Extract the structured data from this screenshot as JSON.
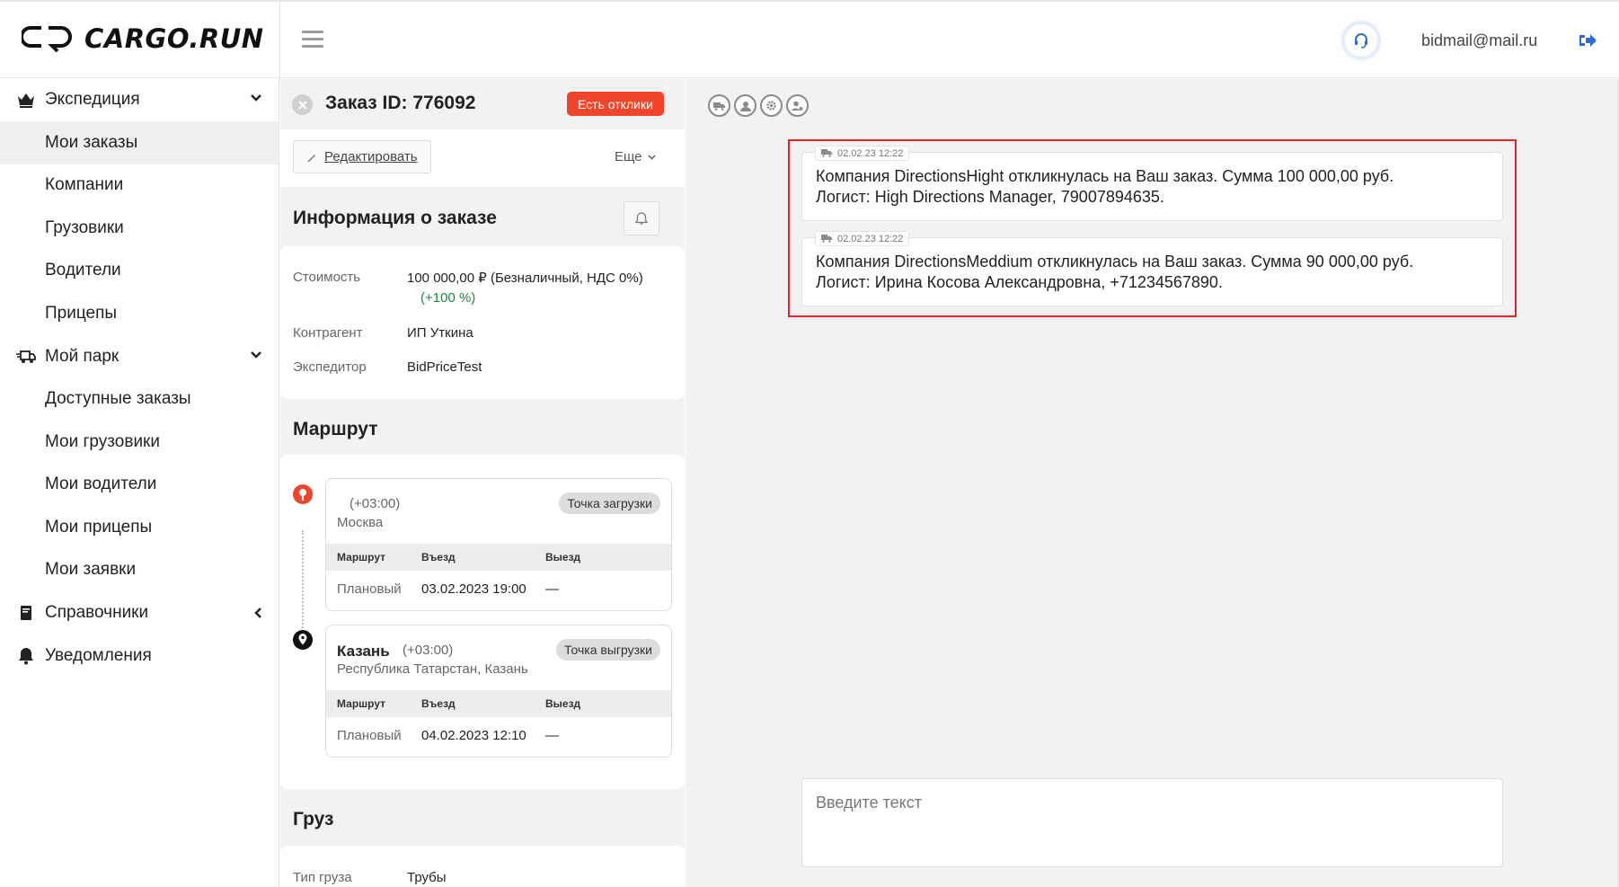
{
  "header": {
    "logo_text": "CARGO.RUN",
    "user_email": "bidmail@mail.ru"
  },
  "sidebar": {
    "groups": [
      {
        "label": "Экспедиция",
        "icon": "crown-icon",
        "expanded": true,
        "items": [
          "Мои заказы",
          "Компании",
          "Грузовики",
          "Водители",
          "Прицепы"
        ]
      },
      {
        "label": "Мой парк",
        "icon": "truck-fast-icon",
        "expanded": true,
        "items": [
          "Доступные заказы",
          "Мои грузовики",
          "Мои водители",
          "Мои прицепы",
          "Мои заявки"
        ]
      },
      {
        "label": "Справочники",
        "icon": "book-icon",
        "expanded": false,
        "items": []
      },
      {
        "label": "Уведомления",
        "icon": "bell-icon",
        "expanded": false,
        "items": []
      }
    ],
    "active_item": "Мои заказы"
  },
  "order": {
    "title": "Заказ ID: 776092",
    "responses_badge": "Есть отклики",
    "edit_label": "Редактировать",
    "more_label": "Еще"
  },
  "info": {
    "title": "Информация о заказе",
    "rows": [
      {
        "label": "Стоимость",
        "value": "100 000,00 ₽ (Безналичный, НДС 0%)",
        "extra": "(+100 %)"
      },
      {
        "label": "Контрагент",
        "value": "ИП Уткина"
      },
      {
        "label": "Экспедитор",
        "value": "BidPriceTest"
      }
    ]
  },
  "route": {
    "title": "Маршрут",
    "columns": [
      "Маршрут",
      "Въезд",
      "Выезд"
    ],
    "points": [
      {
        "city": "",
        "tz": "(+03:00)",
        "address": "Москва",
        "tag": "Точка загрузки",
        "row": {
          "type": "Плановый",
          "in": "03.02.2023 19:00",
          "out": "—"
        }
      },
      {
        "city": "Казань",
        "tz": "(+03:00)",
        "address": "Республика Татарстан, Казань",
        "tag": "Точка выгрузки",
        "row": {
          "type": "Плановый",
          "in": "04.02.2023 12:10",
          "out": "—"
        }
      }
    ]
  },
  "cargo": {
    "title": "Груз",
    "rows": [
      {
        "label": "Тип груза",
        "value": "Трубы"
      }
    ]
  },
  "chat": {
    "messages": [
      {
        "time": "02.02.23 12:22",
        "line1": "Компания DirectionsHight откликнулась на Ваш заказ. Сумма 100 000,00 руб.",
        "line2": "Логист: High Directions Manager, 79007894635."
      },
      {
        "time": "02.02.23 12:22",
        "line1": "Компания DirectionsMeddium откликнулась на Ваш заказ. Сумма 90 000,00 руб.",
        "line2": "Логист: Ирина Косова Александровна, +71234567890."
      }
    ],
    "input_placeholder": "Введите текст"
  },
  "colors": {
    "accent_red": "#f0452b",
    "highlight_red": "#e0242b",
    "link_blue": "#2f6ad9",
    "positive_green": "#1a8a3a"
  }
}
